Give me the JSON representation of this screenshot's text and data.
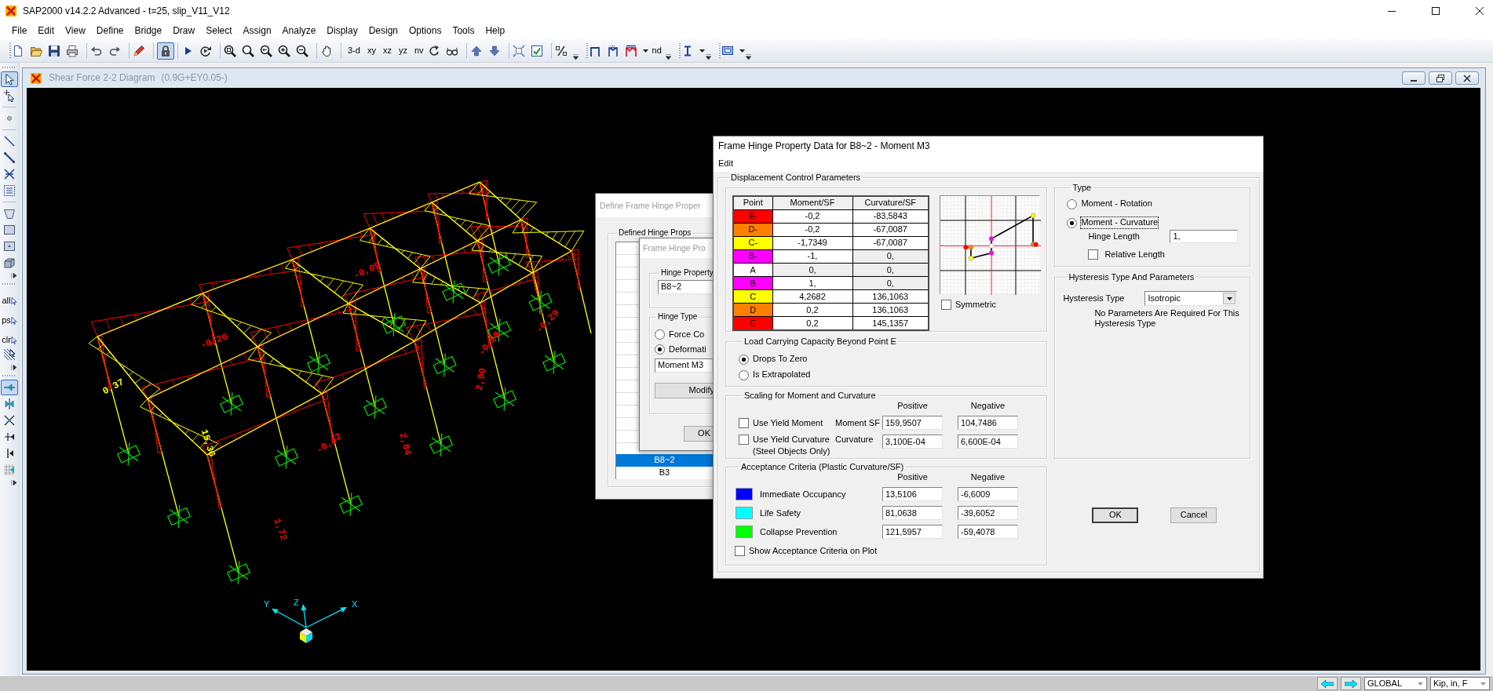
{
  "app_window": {
    "title": "SAP2000 v14.2.2 Advanced - t=25, slip_V11_V12"
  },
  "menu": [
    "File",
    "Edit",
    "View",
    "Define",
    "Bridge",
    "Draw",
    "Select",
    "Assign",
    "Analyze",
    "Display",
    "Design",
    "Options",
    "Tools",
    "Help"
  ],
  "toolbar": {
    "lock_pressed": true,
    "view_buttons": [
      {
        "label": "3-d"
      },
      {
        "label": "xy"
      },
      {
        "label": "xz"
      },
      {
        "label": "yz"
      },
      {
        "label": "nv"
      }
    ],
    "node_button": {
      "label": "nd"
    }
  },
  "side_toolbar": {
    "pointer_pressed": true,
    "snap_pressed": true,
    "select_buttons": [
      {
        "label": "all"
      },
      {
        "label": "ps"
      },
      {
        "label": "clr"
      }
    ]
  },
  "view_window": {
    "title": "Shear Force 2-2 Diagram",
    "load_case": "(0.9G+EY0.05-)",
    "value_labels": [
      {
        "text": "0,37",
        "color": "#ffff00"
      },
      {
        "text": "15,36",
        "color": "#ffff00"
      },
      {
        "text": "-0,20",
        "color": "#ff0000"
      },
      {
        "text": "-0,09",
        "color": "#ff0000"
      },
      {
        "text": "-0,28",
        "color": "#ff0000"
      },
      {
        "text": "-0,29",
        "color": "#ff0000"
      },
      {
        "text": "2,90",
        "color": "#ff0000"
      },
      {
        "text": "2,84",
        "color": "#ff0000"
      },
      {
        "text": "-0,42",
        "color": "#ff0000"
      },
      {
        "text": "1,72",
        "color": "#ff0000"
      }
    ],
    "axis_labels": [
      "Y",
      "Z",
      "X"
    ]
  },
  "define_dialog": {
    "title": "Define Frame Hinge Proper",
    "list_title": "Defined Hinge Props",
    "items": [
      {
        "label": "B8~2",
        "selected": true
      },
      {
        "label": "B3",
        "selected": false
      }
    ]
  },
  "hinge_dialog": {
    "title": "Frame Hinge Pro",
    "property_title": "Hinge Property",
    "property_name": "B8~2",
    "type_title": "Hinge Type",
    "type_options": [
      {
        "label": "Force Co",
        "selected": false
      },
      {
        "label": "Deformati",
        "selected": true
      }
    ],
    "type_value": "Moment M3",
    "modify_button": "Modify",
    "ok_button": "OK"
  },
  "data_dialog": {
    "title": "Frame Hinge Property Data for B8~2 - Moment M3",
    "menu": [
      "Edit"
    ],
    "main_group": "Displacement Control Parameters",
    "points_table": {
      "columns": [
        "Point",
        "Moment/SF",
        "Curvature/SF"
      ],
      "rows": [
        {
          "cells": [
            {
              "text": "E-",
              "color": "#ff0000"
            },
            {
              "text": "-0,2",
              "readonly": false
            },
            {
              "text": "-83,5843",
              "readonly": false
            }
          ]
        },
        {
          "cells": [
            {
              "text": "D-",
              "color": "#ff8000"
            },
            {
              "text": "-0,2",
              "readonly": false
            },
            {
              "text": "-67,0087",
              "readonly": false
            }
          ]
        },
        {
          "cells": [
            {
              "text": "C-",
              "color": "#ffff00"
            },
            {
              "text": "-1,7349",
              "readonly": false
            },
            {
              "text": "-67,0087",
              "readonly": false
            }
          ]
        },
        {
          "cells": [
            {
              "text": "B-",
              "color": "#ff00ff"
            },
            {
              "text": "-1,",
              "readonly": false
            },
            {
              "text": "0,",
              "readonly": true
            }
          ]
        },
        {
          "cells": [
            {
              "text": "A",
              "color": "#ffffff"
            },
            {
              "text": "0,",
              "readonly": true
            },
            {
              "text": "0,",
              "readonly": true
            }
          ]
        },
        {
          "cells": [
            {
              "text": "B",
              "color": "#ff00ff"
            },
            {
              "text": "1,",
              "readonly": false
            },
            {
              "text": "0,",
              "readonly": true
            }
          ]
        },
        {
          "cells": [
            {
              "text": "C",
              "color": "#ffff00"
            },
            {
              "text": "4,2682",
              "readonly": false
            },
            {
              "text": "136,1063",
              "readonly": false
            }
          ]
        },
        {
          "cells": [
            {
              "text": "D",
              "color": "#ff8000"
            },
            {
              "text": "0,2",
              "readonly": false
            },
            {
              "text": "136,1063",
              "readonly": false
            }
          ]
        },
        {
          "cells": [
            {
              "text": "E",
              "color": "#ff0000"
            },
            {
              "text": "0,2",
              "readonly": false
            },
            {
              "text": "145,1357",
              "readonly": false
            }
          ]
        }
      ]
    },
    "symmetric": {
      "label": "Symmetric",
      "checked": false
    },
    "type_group": {
      "title": "Type",
      "options": [
        {
          "label": "Moment - Rotation",
          "selected": false,
          "focused": false
        },
        {
          "label": "Moment - Curvature",
          "selected": true,
          "focused": true
        }
      ],
      "hinge_length": {
        "label": "Hinge Length",
        "value": "1,"
      },
      "relative_length": {
        "label": "Relative Length",
        "checked": false
      }
    },
    "hysteresis_group": {
      "title": "Hysteresis Type And Parameters",
      "type_label": "Hysteresis Type",
      "type_value": "Isotropic",
      "note": "No Parameters Are Required For This Hysteresis Type"
    },
    "load_group": {
      "title": "Load Carrying Capacity Beyond Point E",
      "options": [
        {
          "label": "Drops To Zero",
          "selected": true
        },
        {
          "label": "Is Extrapolated",
          "selected": false
        }
      ]
    },
    "scaling_group": {
      "title": "Scaling for Moment and Curvature",
      "headers": [
        "Positive",
        "Negative"
      ],
      "rows": [
        {
          "check_label": "Use Yield Moment",
          "checked": false,
          "field_label": "Moment SF",
          "positive": "159,9507",
          "negative": "104,7486"
        },
        {
          "check_label": "Use Yield Curvature",
          "check_note": "(Steel Objects Only)",
          "checked": false,
          "field_label": "Curvature",
          "positive": "3,100E-04",
          "negative": "6,600E-04"
        }
      ]
    },
    "acceptance_group": {
      "title": "Acceptance Criteria (Plastic Curvature/SF)",
      "headers": [
        "Positive",
        "Negative"
      ],
      "rows": [
        {
          "label": "Immediate Occupancy",
          "color": "#0000ff",
          "positive": "13,5106",
          "negative": "-6,6009"
        },
        {
          "label": "Life Safety",
          "color": "#00ffff",
          "positive": "81,0638",
          "negative": "-39,6052"
        },
        {
          "label": "Collapse Prevention",
          "color": "#00ff00",
          "positive": "121,5957",
          "negative": "-59,4078"
        }
      ],
      "show_on_plot": {
        "label": "Show Acceptance Criteria on Plot",
        "checked": false
      }
    },
    "buttons": [
      {
        "label": "OK",
        "default": true
      },
      {
        "label": "Cancel",
        "default": false
      }
    ]
  },
  "status_bar": {
    "coord_system": "GLOBAL",
    "units": "Kip, in, F"
  }
}
